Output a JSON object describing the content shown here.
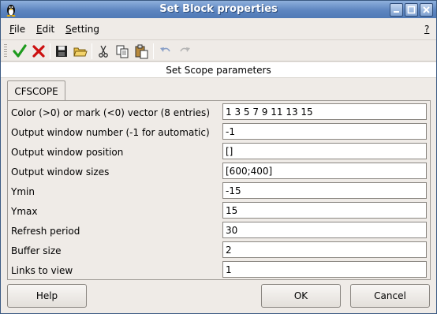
{
  "window": {
    "title": "Set Block properties",
    "help_mark": "?"
  },
  "menu": {
    "file_u": "F",
    "file_rest": "ile",
    "edit_u": "E",
    "edit_rest": "dit",
    "setting_u": "S",
    "setting_rest": "etting"
  },
  "header": "Set Scope parameters",
  "tab": "CFSCOPE",
  "fields": [
    {
      "label": "Color (>0) or mark (<0) vector (8 entries)",
      "value": "1 3 5 7 9 11 13 15"
    },
    {
      "label": "Output window number (-1 for automatic)",
      "value": "-1"
    },
    {
      "label": "Output window position",
      "value": "[]"
    },
    {
      "label": "Output window sizes",
      "value": "[600;400]"
    },
    {
      "label": "Ymin",
      "value": "-15"
    },
    {
      "label": "Ymax",
      "value": "15"
    },
    {
      "label": "Refresh period",
      "value": "30"
    },
    {
      "label": "Buffer size",
      "value": "2"
    },
    {
      "label": "Links to view",
      "value": "1"
    }
  ],
  "buttons": {
    "help": "Help",
    "ok": "OK",
    "cancel": "Cancel"
  },
  "icons": {
    "app": "tux-icon",
    "apply": "checkmark-icon",
    "discard": "x-icon",
    "save": "save-icon",
    "open": "open-folder-icon",
    "cut": "scissors-icon",
    "copy": "copy-icon",
    "paste": "paste-icon",
    "undo": "undo-icon",
    "redo": "redo-icon"
  },
  "colors": {
    "titlebar": "#5d85c0",
    "check": "#1e9b1e",
    "cross": "#cc1010"
  }
}
